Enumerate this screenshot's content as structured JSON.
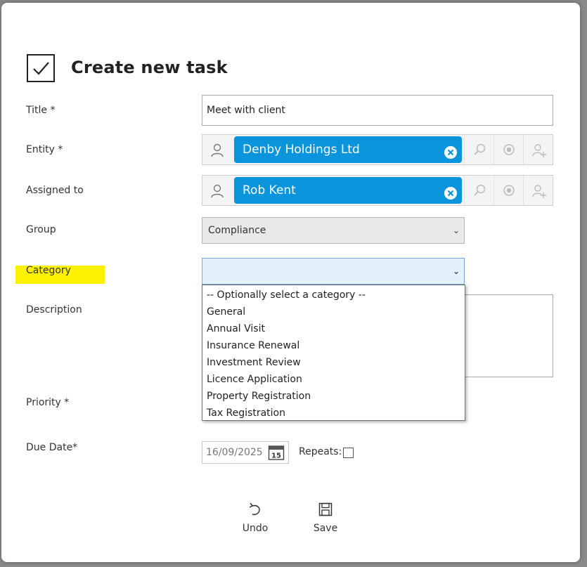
{
  "header": {
    "title": "Create new task",
    "icon": "task-checkbox-icon"
  },
  "form": {
    "title": {
      "label": "Title *",
      "value": "Meet with client"
    },
    "entity": {
      "label": "Entity *",
      "chip": "Denby Holdings Ltd"
    },
    "assigned_to": {
      "label": "Assigned to",
      "chip": "Rob Kent"
    },
    "group": {
      "label": "Group",
      "value": "Compliance"
    },
    "category": {
      "label": "Category",
      "value": "",
      "highlight_color": "#fff200",
      "options": [
        "-- Optionally select a category --",
        "General",
        "Annual Visit",
        "Insurance Renewal",
        "Investment Review",
        "Licence Application",
        "Property Registration",
        "Tax Registration"
      ]
    },
    "description": {
      "label": "Description",
      "value": ""
    },
    "priority": {
      "label": "Priority *"
    },
    "due_date": {
      "label": "Due Date*",
      "value": "16/09/2025",
      "calendar_day": "15"
    },
    "repeats": {
      "label": "Repeats:",
      "checked": false
    }
  },
  "actions": {
    "undo": "Undo",
    "save": "Save"
  },
  "colors": {
    "chip": "#0a94dc",
    "highlight": "#fff200"
  }
}
